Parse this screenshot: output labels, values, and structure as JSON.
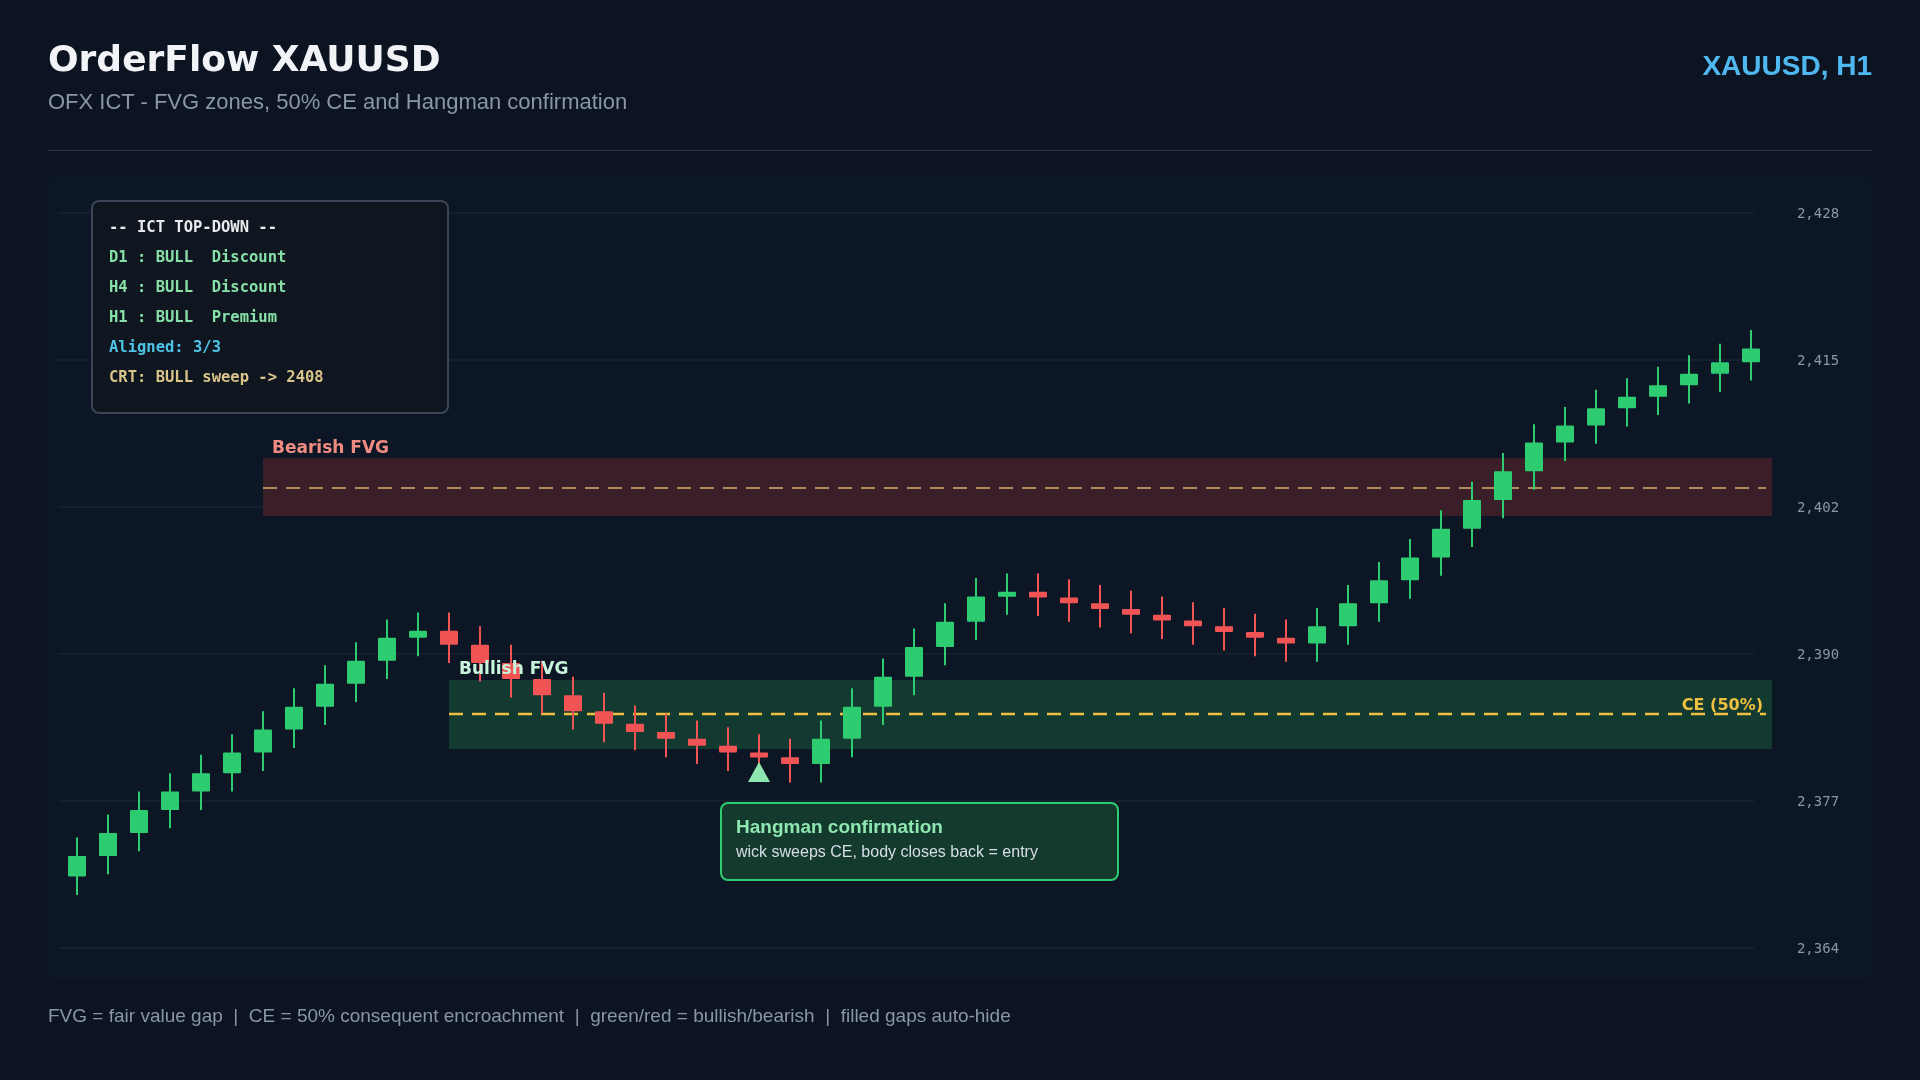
{
  "header": {
    "title": "OrderFlow XAUUSD",
    "subtitle": "OFX ICT - FVG zones, 50% CE and Hangman confirmation",
    "symbol": "XAUUSD, H1"
  },
  "chart": {
    "y_axis": [
      "2,428",
      "2,415",
      "2,402",
      "2,390",
      "2,377",
      "2,364"
    ],
    "zones": [
      {
        "kind": "bearish",
        "label": "Bearish FVG"
      },
      {
        "kind": "bullish",
        "label": "Bullish FVG",
        "ce_label": "CE (50%)"
      }
    ],
    "info_panel": [
      {
        "kind": "header",
        "text": "-- ICT TOP-DOWN --"
      },
      {
        "kind": "bull",
        "text": "D1 : BULL  Discount"
      },
      {
        "kind": "bull",
        "text": "H4 : BULL  Discount"
      },
      {
        "kind": "bull",
        "text": "H1 : BULL  Premium"
      },
      {
        "kind": "aligned",
        "text": "Aligned: 3/3"
      },
      {
        "kind": "crt",
        "text": "CRT: BULL sweep -> 2408"
      }
    ],
    "callout": {
      "title": "Hangman confirmation",
      "text": "wick sweeps CE, body closes back = entry"
    }
  },
  "footer": "FVG = fair value gap  |  CE = 50% consequent encroachment  |  green/red = bullish/bearish  |  filled gaps auto-hide"
}
